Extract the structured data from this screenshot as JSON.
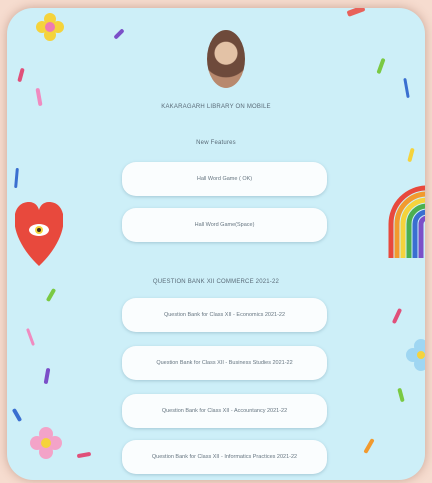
{
  "profile": {
    "title": "KAKARAGARH LIBRARY ON MOBILE"
  },
  "sections": [
    {
      "heading": "New Features",
      "links": [
        "Hall Word Game ( OK)",
        "Hall Word Game(Space)"
      ]
    },
    {
      "heading": "QUESTION BANK XII COMMERCE 2021-22",
      "links": [
        "Question Bank for Class XII - Economics 2021-22",
        "Question Bank for Class XII - Business Studies 2021-22",
        "Question Bank for Class XII - Accountancy 2021-22",
        "Question Bank for Class XII - Informatics Practices 2021-22"
      ]
    }
  ],
  "colors": {
    "page_bg": "#f6dccf",
    "panel_bg": "#cdeff8",
    "button_bg": "#fafdfe"
  }
}
